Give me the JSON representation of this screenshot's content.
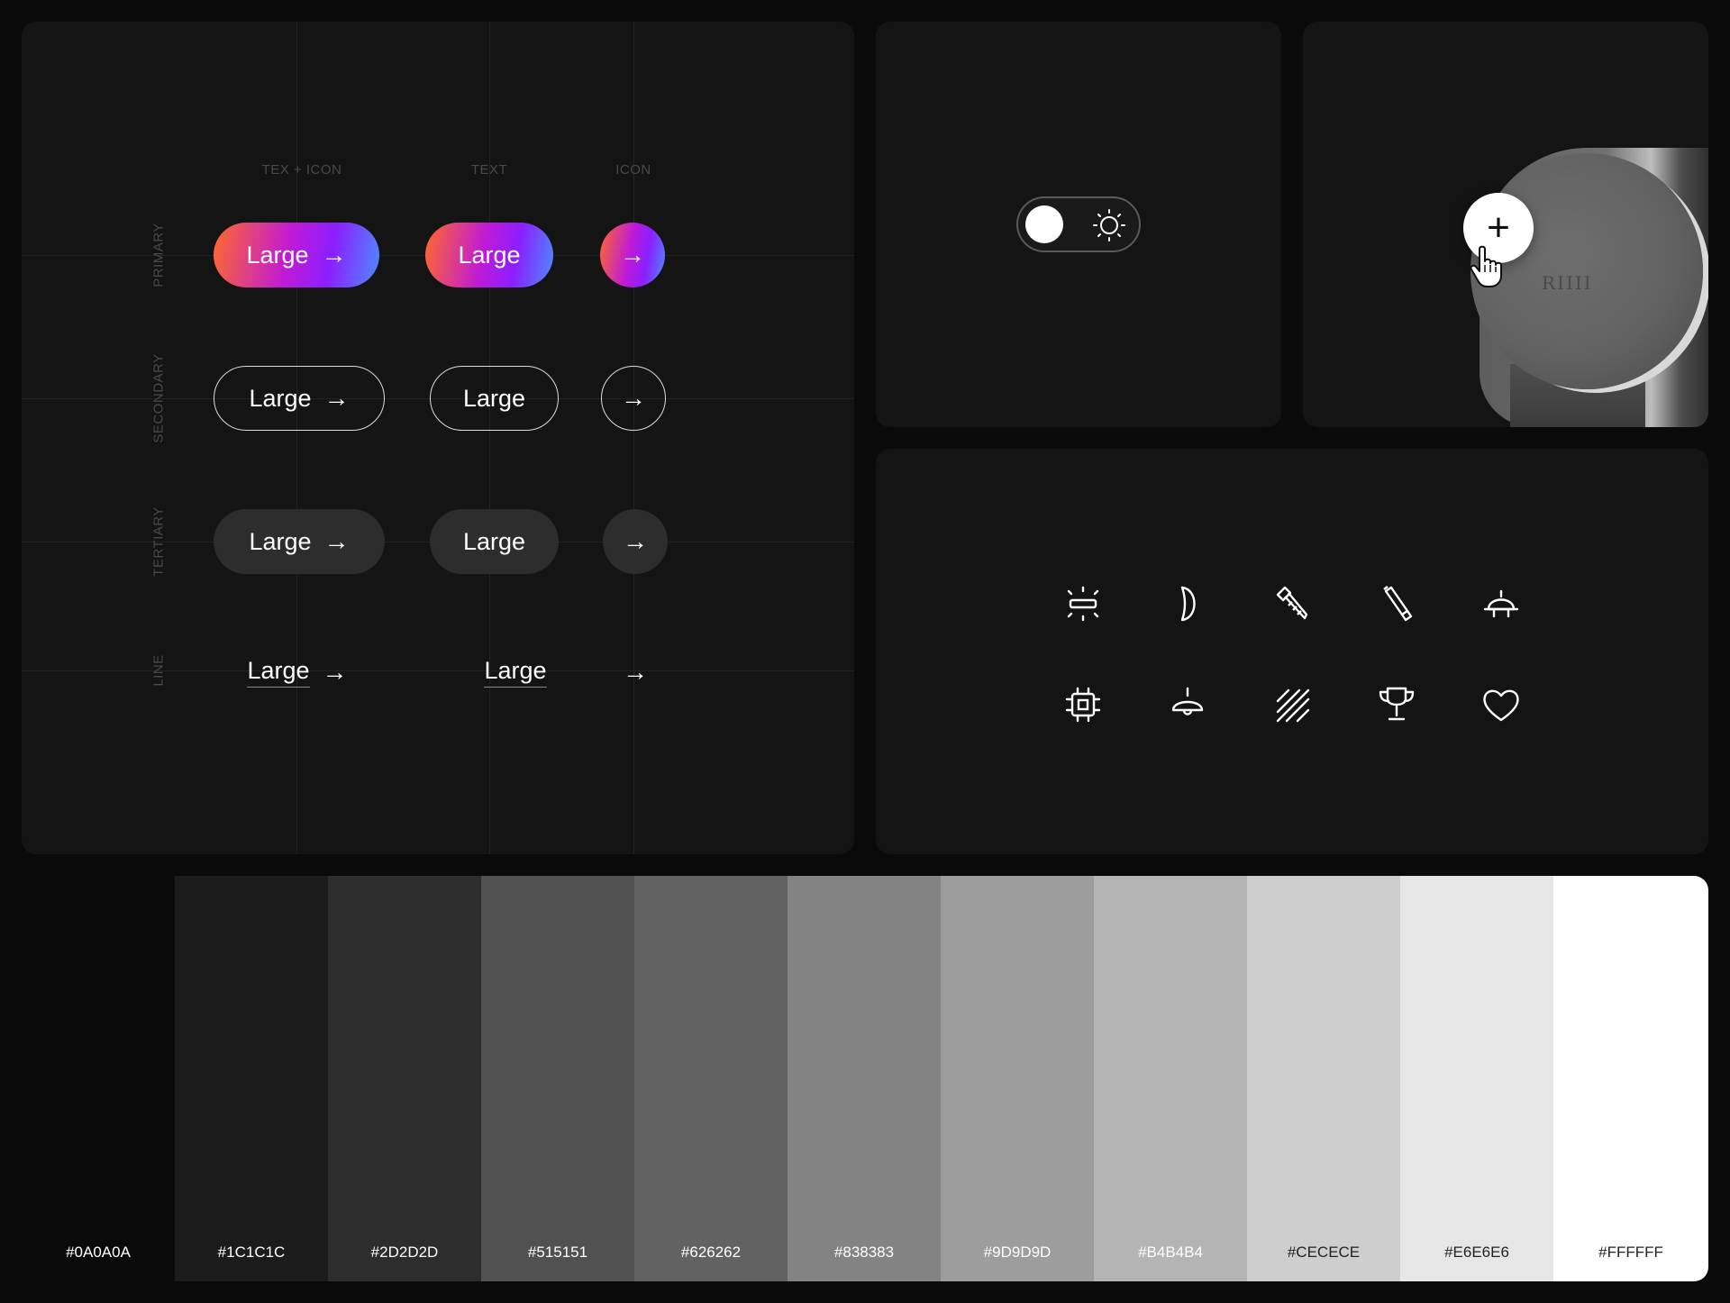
{
  "buttons_panel": {
    "columns": [
      "TEX + ICON",
      "TEXT",
      "ICON"
    ],
    "rows": [
      "PRIMARY",
      "SECONDARY",
      "TERTIARY",
      "LINE"
    ],
    "label": "Large",
    "arrow": "→"
  },
  "toggle": {
    "state": "dark",
    "icon": "sun-icon"
  },
  "device": {
    "logo_text": "RIIII",
    "add_button_glyph": "+"
  },
  "icons": [
    "light-bar-icon",
    "lens-icon",
    "screw-icon",
    "tube-icon",
    "desk-lamp-icon",
    "chip-icon",
    "pendant-lamp-icon",
    "hatch-icon",
    "trophy-icon",
    "heart-icon"
  ],
  "palette": [
    {
      "label": "#0A0A0A",
      "color": "#0a0a0a",
      "text_color": "#ffffff"
    },
    {
      "label": "#1C1C1C",
      "color": "#1c1c1c",
      "text_color": "#ffffff"
    },
    {
      "label": "#2D2D2D",
      "color": "#2d2d2d",
      "text_color": "#ffffff"
    },
    {
      "label": "#515151",
      "color": "#515151",
      "text_color": "#ffffff"
    },
    {
      "label": "#626262",
      "color": "#626262",
      "text_color": "#ffffff"
    },
    {
      "label": "#838383",
      "color": "#838383",
      "text_color": "#ffffff"
    },
    {
      "label": "#9D9D9D",
      "color": "#9d9d9d",
      "text_color": "#ffffff"
    },
    {
      "label": "#B4B4B4",
      "color": "#b4b4b4",
      "text_color": "#ffffff"
    },
    {
      "label": "#CECECE",
      "color": "#cecece",
      "text_color": "#222222"
    },
    {
      "label": "#E6E6E6",
      "color": "#e6e6e6",
      "text_color": "#222222"
    },
    {
      "label": "#FFFFFF",
      "color": "#ffffff",
      "text_color": "#222222"
    }
  ]
}
